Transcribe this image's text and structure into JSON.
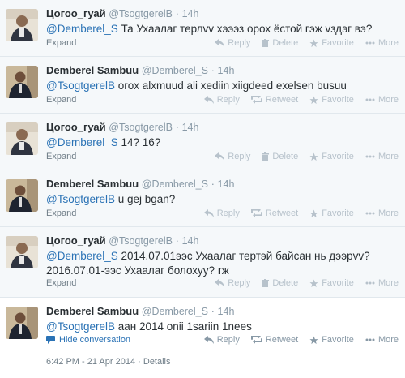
{
  "tweets": [
    {
      "fullname": "Цогоо_гуай",
      "username": "@TsogtgerelB",
      "time": "14h",
      "mention": "@Demberel_S",
      "text": " Та Ухаалаг терлvv хэээз орох ёстой гэж vздэг вэ?",
      "expand": "Expand",
      "actions": [
        "Reply",
        "Delete",
        "Favorite",
        "More"
      ]
    },
    {
      "fullname": "Demberel Sambuu",
      "username": "@Demberel_S",
      "time": "14h",
      "mention": "@TsogtgerelB",
      "text": " orox alxmuud ali xediin xiigdeed exelsen busuu",
      "expand": "Expand",
      "actions": [
        "Reply",
        "Retweet",
        "Favorite",
        "More"
      ]
    },
    {
      "fullname": "Цогоо_гуай",
      "username": "@TsogtgerelB",
      "time": "14h",
      "mention": "@Demberel_S",
      "text": " 14? 16?",
      "expand": "Expand",
      "actions": [
        "Reply",
        "Delete",
        "Favorite",
        "More"
      ]
    },
    {
      "fullname": "Demberel Sambuu",
      "username": "@Demberel_S",
      "time": "14h",
      "mention": "@TsogtgerelB",
      "text": " u gej bgan?",
      "expand": "Expand",
      "actions": [
        "Reply",
        "Retweet",
        "Favorite",
        "More"
      ]
    },
    {
      "fullname": "Цогоо_гуай",
      "username": "@TsogtgerelB",
      "time": "14h",
      "mention": "@Demberel_S",
      "text": " 2014.07.01ээс Ухаалаг тертэй байсан нь дээрvv?",
      "text2": "2016.07.01-ээс Ухаалаг болохуу? гж",
      "expand": "Expand",
      "actions": [
        "Reply",
        "Delete",
        "Favorite",
        "More"
      ]
    },
    {
      "fullname": "Demberel Sambuu",
      "username": "@Demberel_S",
      "time": "14h",
      "mention": "@TsogtgerelB",
      "text": " аан 2014 onii 1sariin 1nees",
      "hide": "Hide conversation",
      "actions": [
        "Reply",
        "Retweet",
        "Favorite",
        "More"
      ],
      "timestamp": "6:42 PM - 21 Apr 2014",
      "details": "Details"
    }
  ],
  "dot": "·",
  "colors": {
    "link": "#2a72b5",
    "muted": "#8899a6",
    "bg": "#f5f8fa"
  }
}
